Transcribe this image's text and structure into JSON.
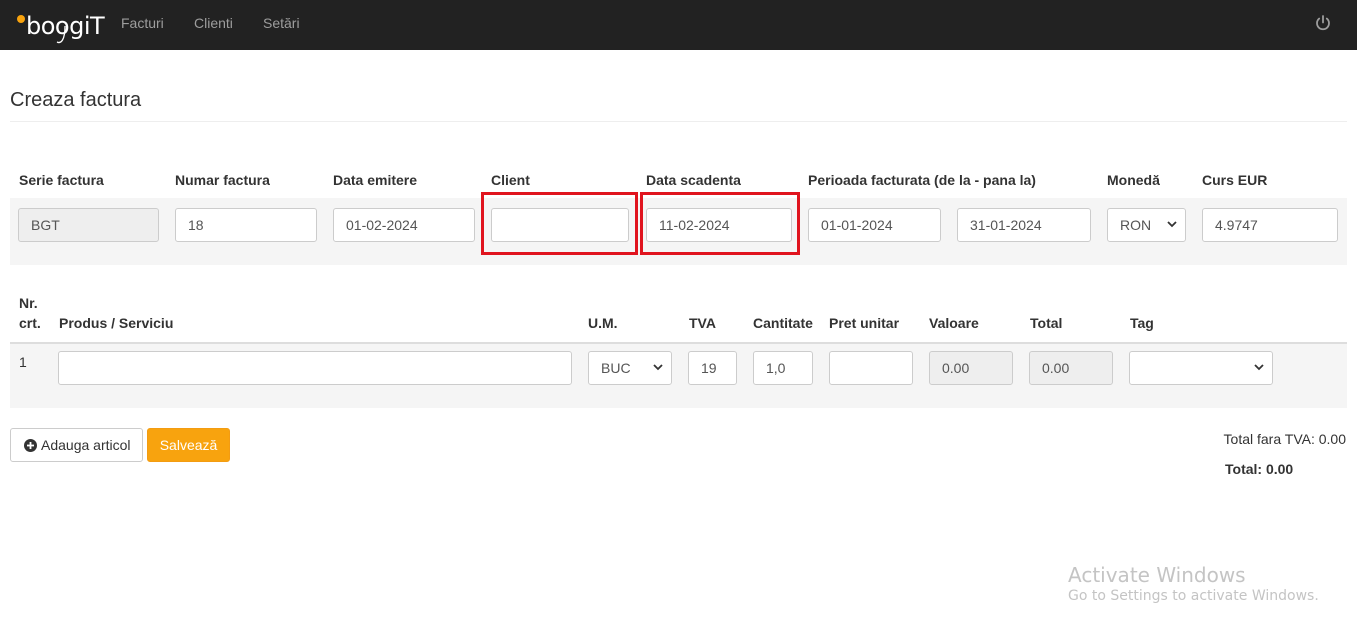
{
  "nav": {
    "brand": "boogiT",
    "links": [
      "Facturi",
      "Clienti",
      "Setări"
    ],
    "power_icon": "power-icon"
  },
  "page": {
    "title": "Creaza factura"
  },
  "invoice_header": {
    "labels": {
      "serie": "Serie factura",
      "numar": "Numar factura",
      "data_emitere": "Data emitere",
      "client": "Client",
      "data_scadenta": "Data scadenta",
      "perioada": "Perioada facturata (de la - pana la)",
      "moneda": "Monedă",
      "curs": "Curs EUR"
    },
    "values": {
      "serie": "BGT",
      "numar": "18",
      "data_emitere": "01-02-2024",
      "client": "",
      "data_scadenta": "11-02-2024",
      "perioada_de_la": "01-01-2024",
      "perioada_pana_la": "31-01-2024",
      "moneda": "RON",
      "curs": "4.9747"
    }
  },
  "items_table": {
    "headers": {
      "nr_line1": "Nr.",
      "nr_line2": "crt.",
      "produs": "Produs / Serviciu",
      "um": "U.M.",
      "tva": "TVA",
      "cantitate": "Cantitate",
      "pret": "Pret unitar",
      "valoare": "Valoare",
      "total": "Total",
      "tag": "Tag"
    },
    "rows": [
      {
        "nr": "1",
        "produs": "",
        "um": "BUC",
        "tva": "19",
        "cantitate": "1,0",
        "pret": "",
        "valoare": "0.00",
        "total": "0.00",
        "tag": ""
      }
    ]
  },
  "actions": {
    "add_label": "Adauga articol",
    "save_label": "Salvează"
  },
  "totals": {
    "fara_tva": "Total fara TVA: 0.00",
    "total": "Total: 0.00"
  },
  "watermark": {
    "line1": "Activate Windows",
    "line2": "Go to Settings to activate Windows."
  },
  "colors": {
    "navbar": "#222222",
    "highlight": "#e0141e",
    "save_button": "#f8a30e",
    "band": "#f5f5f5"
  }
}
